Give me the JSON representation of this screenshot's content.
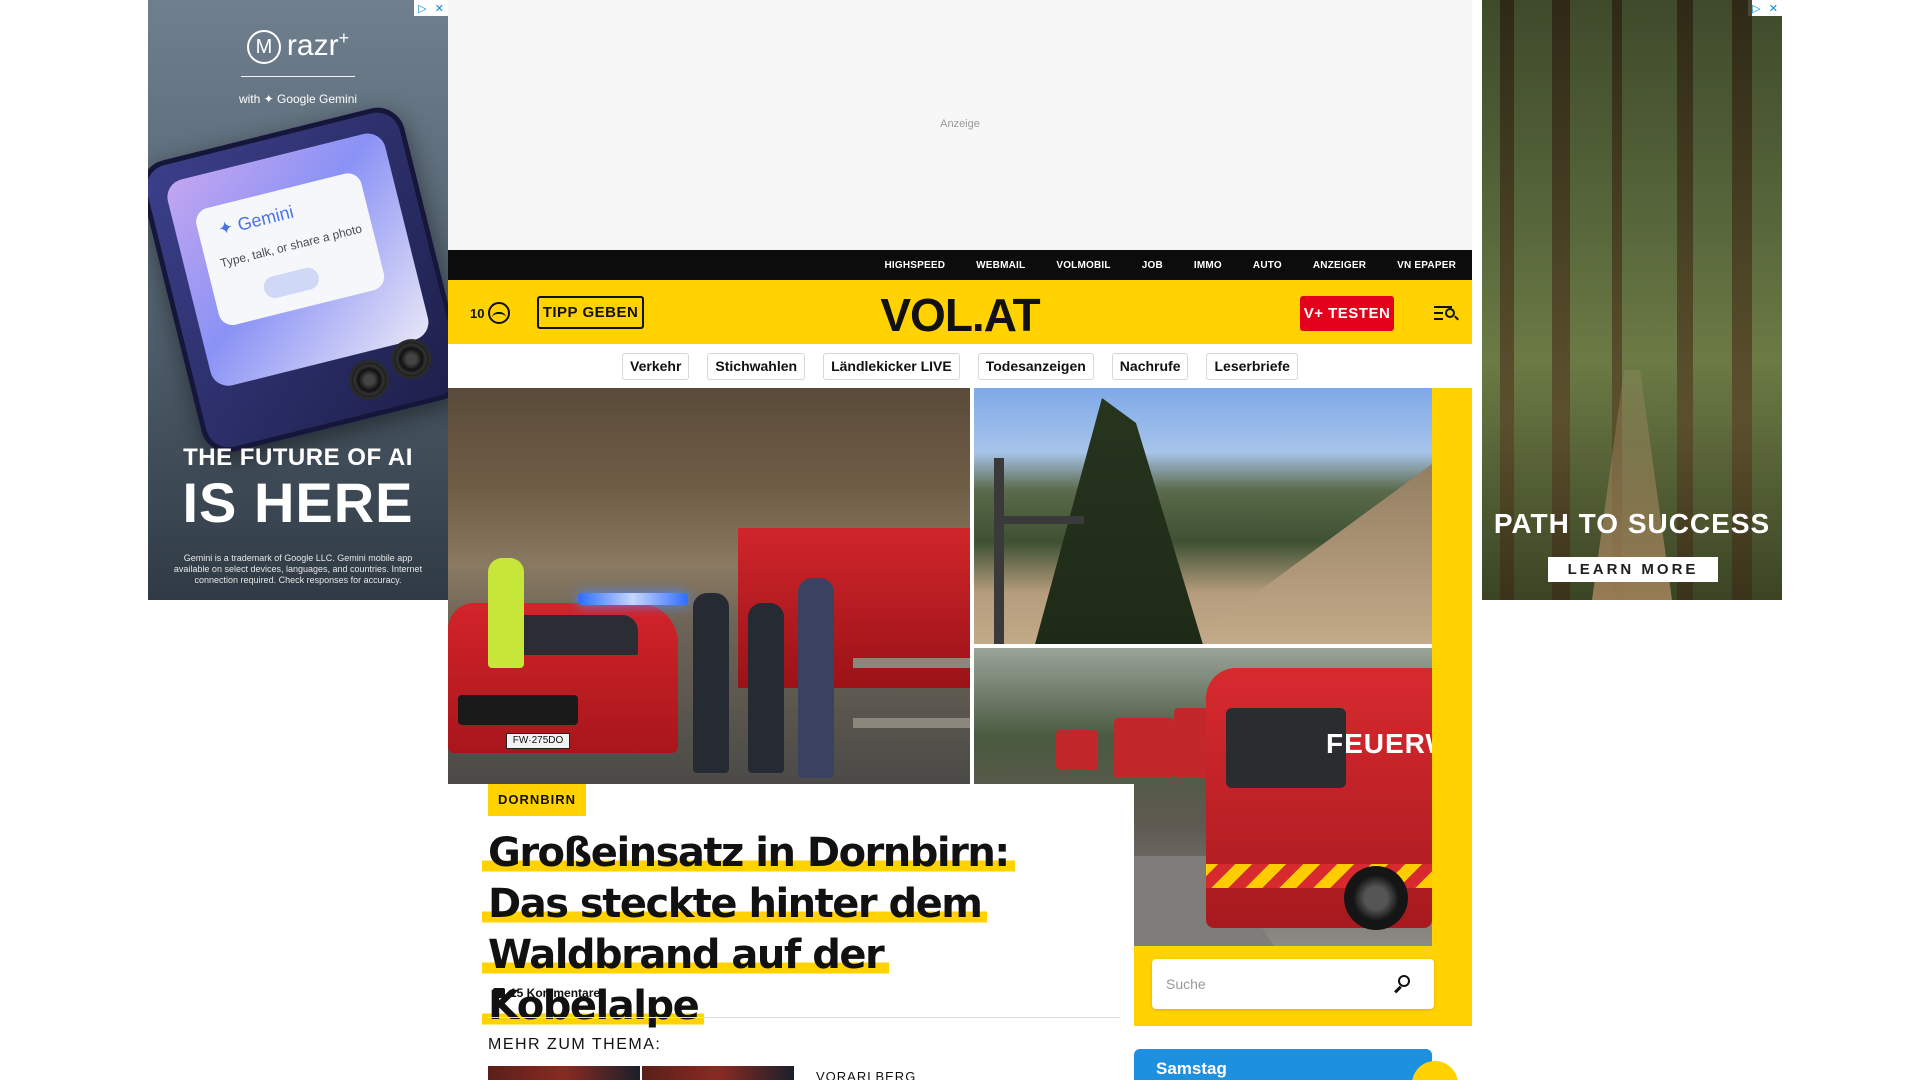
{
  "ads": {
    "left": {
      "brand": "razr",
      "brand_sup": "+",
      "sub": "with ✦ Google Gemini",
      "gemini_label": "✦ Gemini",
      "gemini_prompt": "Type, talk, or share a photo",
      "headline_1": "THE FUTURE OF AI",
      "headline_2": "IS HERE",
      "fine_print": "Gemini is a trademark of Google LLC. Gemini mobile app available on select devices, languages, and countries. Internet connection required. Check responses for accuracy."
    },
    "right": {
      "headline": "PATH TO SUCCESS",
      "cta": "LEARN MORE"
    },
    "top_label": "Anzeige"
  },
  "util_nav": [
    "HIGHSPEED",
    "WEBMAIL",
    "VOLMOBIL",
    "JOB",
    "IMMO",
    "AUTO",
    "ANZEIGER",
    "VN EPAPER"
  ],
  "header": {
    "temperature": "10",
    "tipp_label": "TIPP GEBEN",
    "logo": "VOL.AT",
    "vplus_label": "V+ TESTEN"
  },
  "pills": [
    "Verkehr",
    "Stichwahlen",
    "Ländlekicker LIVE",
    "Todesanzeigen",
    "Nachrufe",
    "Leserbriefe"
  ],
  "hero": {
    "plate": "FW·275DO",
    "van_text": "FEUERW"
  },
  "article": {
    "tag": "DORNBIRN",
    "headline": "Großeinsatz in Dornbirn: Das steckte hinter dem Waldbrand auf der Kobelalpe",
    "comments": "15 Kommentare",
    "more_heading": "MEHR ZUM THEMA:",
    "more_tag": "VORARLBERG"
  },
  "search": {
    "placeholder": "Suche"
  },
  "weather_widget": {
    "day": "Samstag"
  }
}
